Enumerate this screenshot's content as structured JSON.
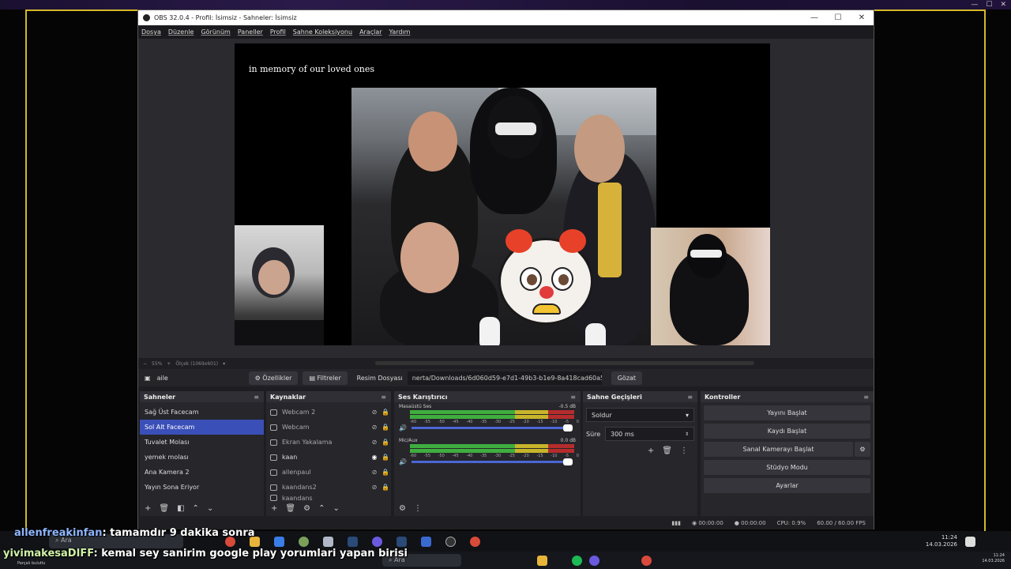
{
  "window": {
    "title": "OBS 32.0.4 - Profil: İsimsiz - Sahneler: İsimsiz",
    "controls": [
      "—",
      "☐",
      "✕"
    ]
  },
  "menu": [
    "Dosya",
    "Düzenle",
    "Görünüm",
    "Paneller",
    "Profil",
    "Sahne Koleksiyonu",
    "Araçlar",
    "Yardım"
  ],
  "preview": {
    "overlay_text": "in memory of our loved ones",
    "zoom": "55%",
    "resolution": "Ölçek (1069x601)"
  },
  "source_bar": {
    "source_name": "aile",
    "properties": "Özellikler",
    "filters": "Filtreler",
    "file_label": "Resim Dosyası",
    "file_path": "nerta/Downloads/6d060d59-e7d1-49b3-b1e9-8a418cad60a5.png",
    "browse": "Gözat"
  },
  "scenes": {
    "header": "Sahneler",
    "items": [
      "Sağ Üst Facecam",
      "Sol Alt Facecam",
      "Tuvalet Molası",
      "yemek molası",
      "Ana Kamera 2",
      "Yayın Sona Eriyor"
    ],
    "selected_index": 1
  },
  "sources": {
    "header": "Kaynaklar",
    "items": [
      "Webcam 2",
      "Webcam",
      "Ekran Yakalama",
      "kaan",
      "allenpaul",
      "kaandans2",
      "kaandans"
    ]
  },
  "mixer": {
    "header": "Ses Karıştırıcı",
    "channels": [
      {
        "name": "Masaüstü Ses",
        "db": "-0.5 dB",
        "level": 0.94
      },
      {
        "name": "Mic/Aux",
        "db": "0.0 dB",
        "level": 1.0
      }
    ],
    "scale": [
      "-60",
      "-55",
      "-50",
      "-45",
      "-40",
      "-35",
      "-30",
      "-25",
      "-20",
      "-15",
      "-10",
      "-5",
      "0"
    ]
  },
  "transitions": {
    "header": "Sahne Geçişleri",
    "type": "Soldur",
    "duration_label": "Süre",
    "duration": "300 ms"
  },
  "controls": {
    "header": "Kontroller",
    "buttons": [
      "Yayını Başlat",
      "Kaydı Başlat",
      "Sanal Kamerayı Başlat",
      "Stüdyo Modu",
      "Ayarlar"
    ]
  },
  "status": {
    "stream_time": "00:00:00",
    "rec_time": "00:00:00",
    "cpu": "CPU: 0.9%",
    "fps": "60.00 / 60.00 FPS"
  },
  "chat": [
    {
      "user": "allenfreakinfan",
      "message": ": tamamdır 9 dakika sonra"
    },
    {
      "user": "yivimakesaDIFF",
      "message": ": kemal sey sanirim google play yorumlari yapan birisi"
    }
  ],
  "taskbar": {
    "search": "Ara",
    "time1": "11:24",
    "date1": "14.03.2026",
    "time2": "11:24",
    "date2": "14.03.2026",
    "weather": "Parçalı bulutlu"
  },
  "colors": {
    "selection": "#3b4fb8",
    "frame": "#d4b82a",
    "meter_green": "#3fae3f"
  }
}
